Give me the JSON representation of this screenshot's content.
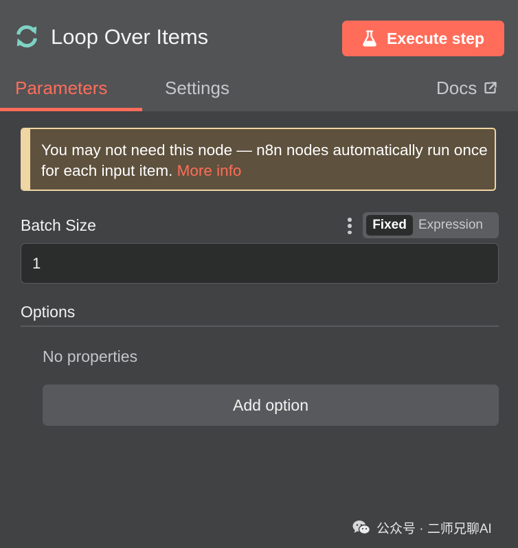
{
  "header": {
    "title": "Loop Over Items",
    "node_icon": "loop-refresh-icon",
    "execute_button": {
      "label": "Execute step",
      "icon": "flask-icon"
    }
  },
  "tabs": [
    {
      "label": "Parameters",
      "active": true
    },
    {
      "label": "Settings",
      "active": false
    }
  ],
  "docs": {
    "label": "Docs",
    "icon": "external-link-icon"
  },
  "notice": {
    "text": "You may not need this node — n8n nodes automatically run once for each input item. ",
    "link": "More info"
  },
  "batch_size": {
    "label": "Batch Size",
    "mode_options": [
      "Fixed",
      "Expression"
    ],
    "mode_selected": "Fixed",
    "value": "1"
  },
  "options": {
    "label": "Options",
    "empty_text": "No properties",
    "add_button": "Add option"
  },
  "watermark": {
    "text": "公众号 · 二师兄聊AI",
    "icon": "wechat-icon"
  },
  "colors": {
    "accent": "#ff6d5a",
    "node_icon": "#7ed3c4",
    "background": "#414244",
    "header_background": "#525355",
    "notice_background": "#5e513d",
    "notice_border": "#f0d6a2"
  }
}
